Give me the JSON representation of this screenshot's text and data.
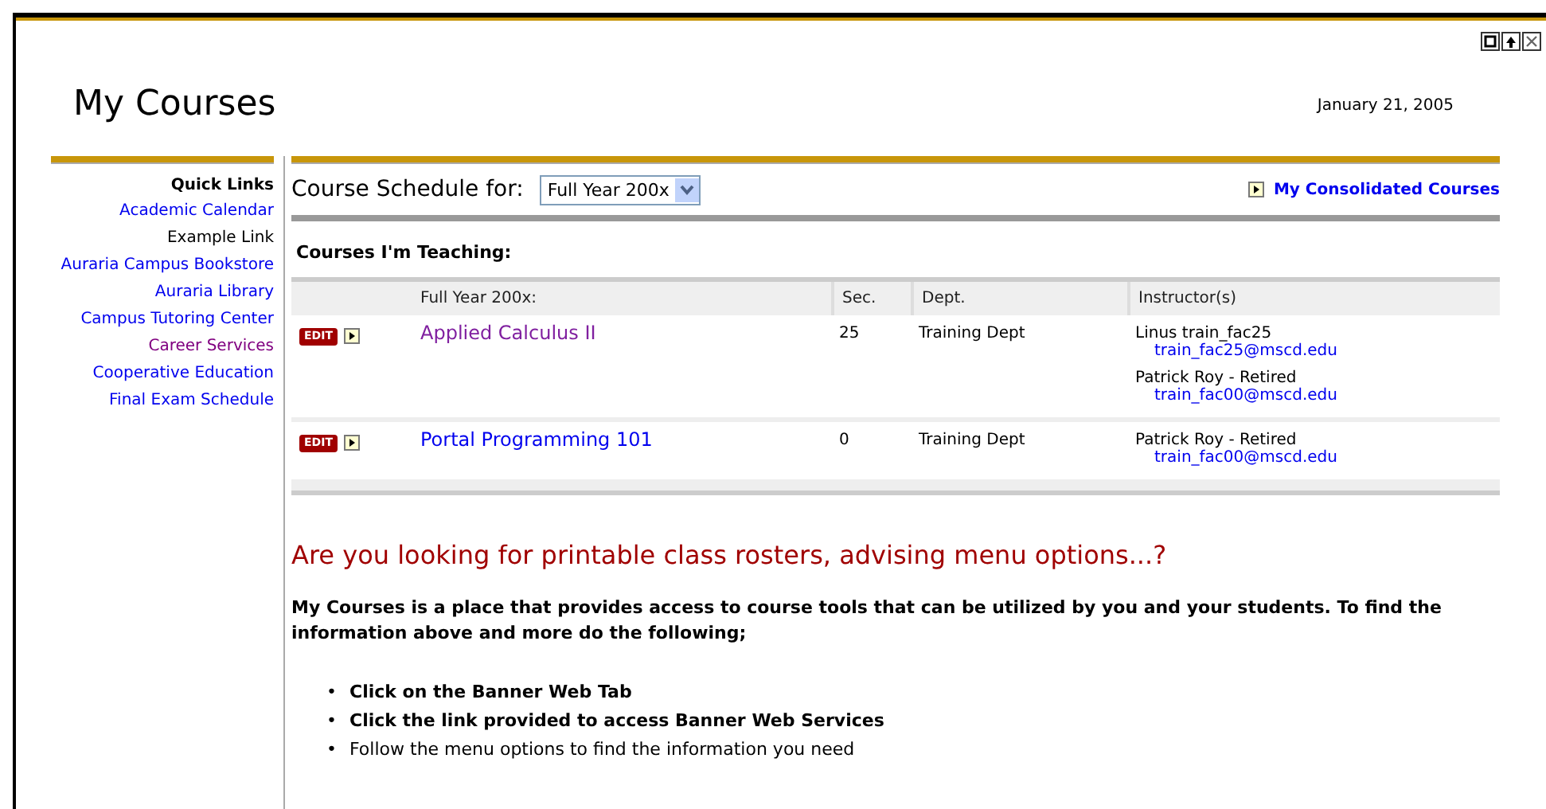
{
  "page": {
    "title": "My Courses",
    "date": "January 21, 2005"
  },
  "quick_links": {
    "title": "Quick Links",
    "items": [
      {
        "label": "Academic Calendar",
        "kind": "link"
      },
      {
        "label": "Example Link",
        "kind": "text"
      },
      {
        "label": "Auraria Campus Bookstore",
        "kind": "link"
      },
      {
        "label": "Auraria Library",
        "kind": "link"
      },
      {
        "label": "Campus Tutoring Center",
        "kind": "link"
      },
      {
        "label": "Career Services",
        "kind": "visited"
      },
      {
        "label": "Cooperative Education",
        "kind": "link"
      },
      {
        "label": "Final Exam Schedule",
        "kind": "link"
      }
    ]
  },
  "schedule": {
    "label": "Course Schedule for:",
    "term": "Full Year 200x",
    "consolidated_link": "My Consolidated Courses"
  },
  "teaching": {
    "title": "Courses I'm Teaching:",
    "columns": [
      "Full Year 200x:",
      "Sec.",
      "Dept.",
      "Instructor(s)"
    ],
    "rows": [
      {
        "edit": "EDIT",
        "course": "Applied Calculus II",
        "visited": true,
        "section": "25",
        "dept": "Training Dept",
        "instructors": [
          {
            "name": "Linus train_fac25",
            "email": "train_fac25@mscd.edu"
          },
          {
            "name": "Patrick Roy - Retired",
            "email": "train_fac00@mscd.edu"
          }
        ]
      },
      {
        "edit": "EDIT",
        "course": "Portal Programming 101",
        "visited": false,
        "section": "0",
        "dept": "Training Dept",
        "instructors": [
          {
            "name": "Patrick Roy - Retired",
            "email": "train_fac00@mscd.edu"
          }
        ]
      }
    ]
  },
  "info": {
    "heading": "Are you looking for printable class rosters, advising menu options...?",
    "paragraph": "My Courses is a place that provides access to course tools that can be utilized by you and your students. To find the information above and more do the following;",
    "steps": [
      {
        "marker": "•",
        "text": "Click on the Banner Web Tab",
        "bold": true
      },
      {
        "marker": "•",
        "text": "Click the link provided to access Banner Web Services",
        "bold": true
      },
      {
        "marker": "•",
        "text": "Follow the menu options to find the information you need",
        "bold": false
      }
    ]
  }
}
